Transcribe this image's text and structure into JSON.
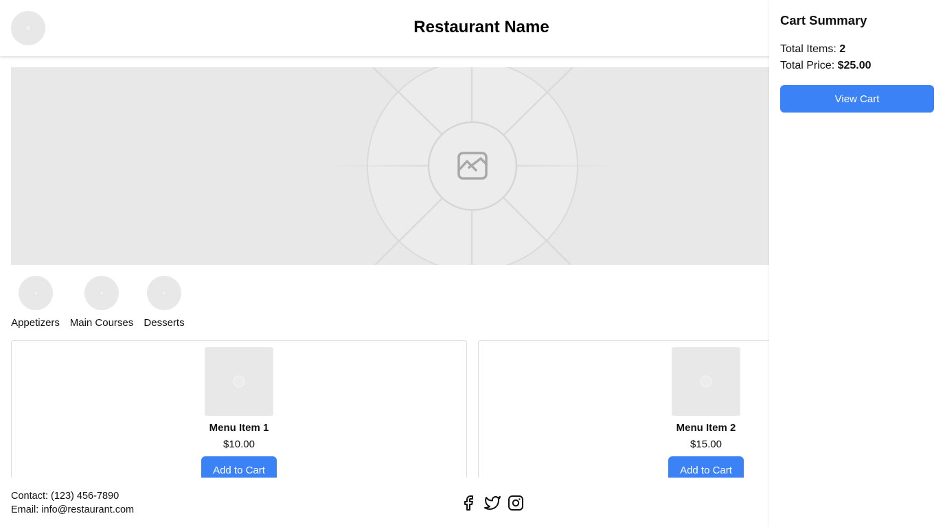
{
  "header": {
    "restaurant_name": "Restaurant Name"
  },
  "hero": {
    "icon": "image-placeholder-icon"
  },
  "categories": [
    {
      "label": "Appetizers"
    },
    {
      "label": "Main Courses"
    },
    {
      "label": "Desserts"
    }
  ],
  "menu_items": [
    {
      "name": "Menu Item 1",
      "price": "$10.00",
      "button_label": "Add to Cart"
    },
    {
      "name": "Menu Item 2",
      "price": "$15.00",
      "button_label": "Add to Cart"
    }
  ],
  "footer": {
    "contact": "Contact: (123) 456-7890",
    "email": "Email: info@restaurant.com",
    "social_icons": [
      "facebook-icon",
      "twitter-icon",
      "instagram-icon"
    ]
  },
  "cart": {
    "title": "Cart Summary",
    "total_items_label": "Total Items: ",
    "total_items_value": "2",
    "total_price_label": "Total Price: ",
    "total_price_value": "$25.00",
    "view_cart_label": "View Cart"
  },
  "colors": {
    "accent": "#3b82f6",
    "placeholder": "#e8e8e8"
  }
}
